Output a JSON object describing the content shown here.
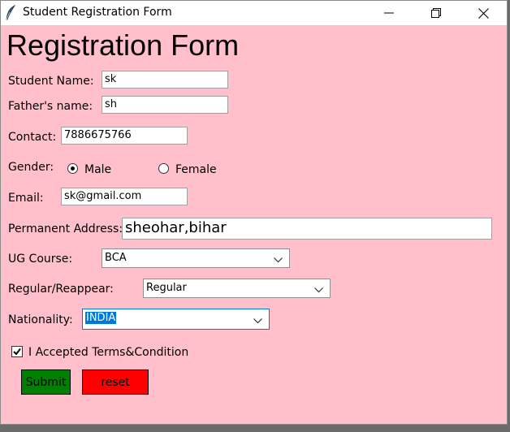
{
  "window": {
    "title": "Student Registration Form",
    "icon": "feather-icon",
    "controls": [
      "minimize-icon",
      "restore-icon",
      "close-icon"
    ]
  },
  "form": {
    "heading": "Registration Form",
    "student_name": {
      "label": "Student Name:",
      "value": "sk"
    },
    "father_name": {
      "label": "Father's name:",
      "value": "sh"
    },
    "contact": {
      "label": "Contact:",
      "value": "7886675766"
    },
    "gender": {
      "label": "Gender:",
      "options": [
        "Male",
        "Female"
      ],
      "selected": "Male"
    },
    "email": {
      "label": "Email:",
      "value": "sk@gmail.com"
    },
    "address": {
      "label": "Permanent Address:",
      "value": "sheohar,bihar"
    },
    "ug_course": {
      "label": "UG Course:",
      "value": "BCA"
    },
    "regular": {
      "label": "Regular/Reappear:",
      "value": "Regular"
    },
    "nationality": {
      "label": "Nationality:",
      "value": "INDIA"
    },
    "terms": {
      "label": "I Accepted Terms&Condition",
      "checked": true
    },
    "submit_label": "Submit",
    "reset_label": "reset"
  },
  "colors": {
    "background": "#ffc0cb",
    "submit": "#008000",
    "reset": "#ff0000",
    "selection": "#0078d7"
  }
}
